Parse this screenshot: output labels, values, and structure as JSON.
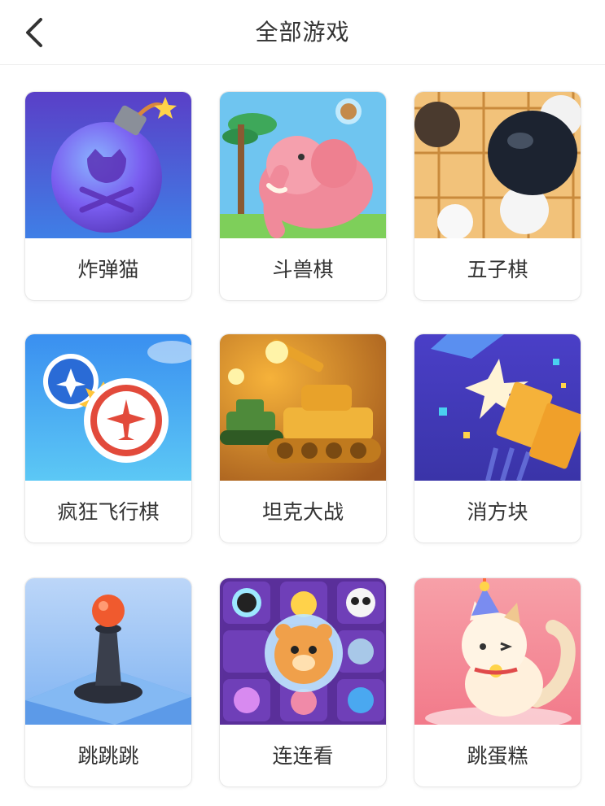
{
  "header": {
    "title": "全部游戏",
    "back_icon": "chevron-left-icon"
  },
  "games": [
    {
      "label": "炸弹猫",
      "icon": "bomb-cat-icon"
    },
    {
      "label": "斗兽棋",
      "icon": "elephant-icon"
    },
    {
      "label": "五子棋",
      "icon": "go-stones-icon"
    },
    {
      "label": "疯狂飞行棋",
      "icon": "airplane-icon"
    },
    {
      "label": "坦克大战",
      "icon": "tank-icon"
    },
    {
      "label": "消方块",
      "icon": "breaking-block-icon"
    },
    {
      "label": "跳跳跳",
      "icon": "chess-pawn-icon"
    },
    {
      "label": "连连看",
      "icon": "animal-faces-icon"
    },
    {
      "label": "跳蛋糕",
      "icon": "party-cat-icon"
    }
  ],
  "colors": {
    "text": "#333333",
    "card_border": "#e8e8e8",
    "background": "#ffffff"
  }
}
